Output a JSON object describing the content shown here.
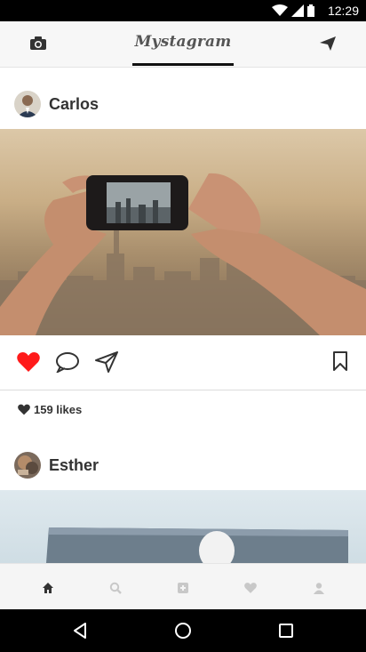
{
  "status_bar": {
    "time": "12:29"
  },
  "app": {
    "title": "Mystagram"
  },
  "posts": [
    {
      "username": "Carlos",
      "likes": "159 likes",
      "liked": true
    },
    {
      "username": "Esther"
    }
  ],
  "icons": {
    "camera": "camera-icon",
    "send": "send-icon",
    "like": "heart-icon",
    "comment": "comment-icon",
    "share": "share-icon",
    "bookmark": "bookmark-icon"
  },
  "bottom_nav": [
    "home-icon",
    "search-icon",
    "add-icon",
    "activity-icon",
    "profile-icon"
  ],
  "colors": {
    "liked": "#ff1a1a",
    "nav_active": "#333333",
    "nav_inactive": "#c8c8c8"
  }
}
